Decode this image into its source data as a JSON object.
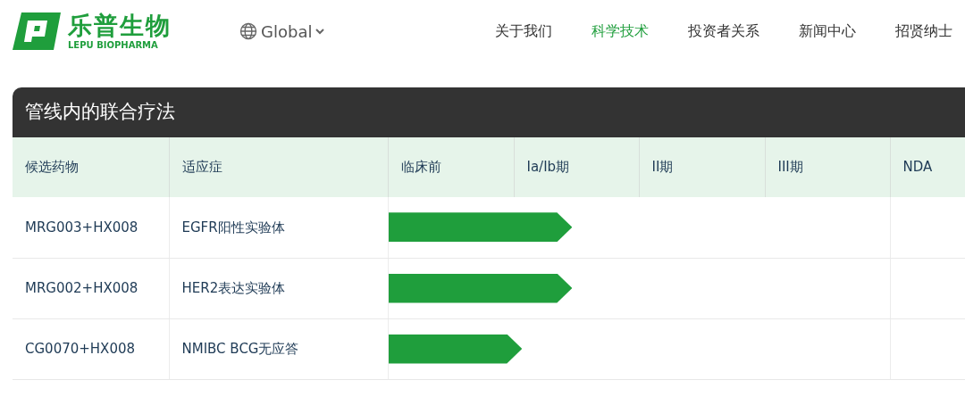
{
  "logo": {
    "name": "乐普生物",
    "subtitle": "LEPU BIOPHARMA"
  },
  "region_selector": {
    "label": "Global"
  },
  "nav": [
    {
      "label": "关于我们",
      "selected": false
    },
    {
      "label": "科学技术",
      "selected": true
    },
    {
      "label": "投资者关系",
      "selected": false
    },
    {
      "label": "新闻中心",
      "selected": false
    },
    {
      "label": "招贤纳士",
      "selected": false
    }
  ],
  "pipeline": {
    "title": "管线内的联合疗法",
    "columns": [
      "候选药物",
      "适应症",
      "临床前",
      "Ia/Ib期",
      "II期",
      "III期",
      "NDA"
    ],
    "rows": [
      {
        "candidate": "MRG003+HX008",
        "indication": "EGFR阳性实验体",
        "level": 0.367
      },
      {
        "candidate": "MRG002+HX008",
        "indication": "HER2表达实验体",
        "level": 0.367
      },
      {
        "candidate": "CG0070+HX008",
        "indication": "NMIBC BCG无应答",
        "level": 0.267
      }
    ]
  }
}
